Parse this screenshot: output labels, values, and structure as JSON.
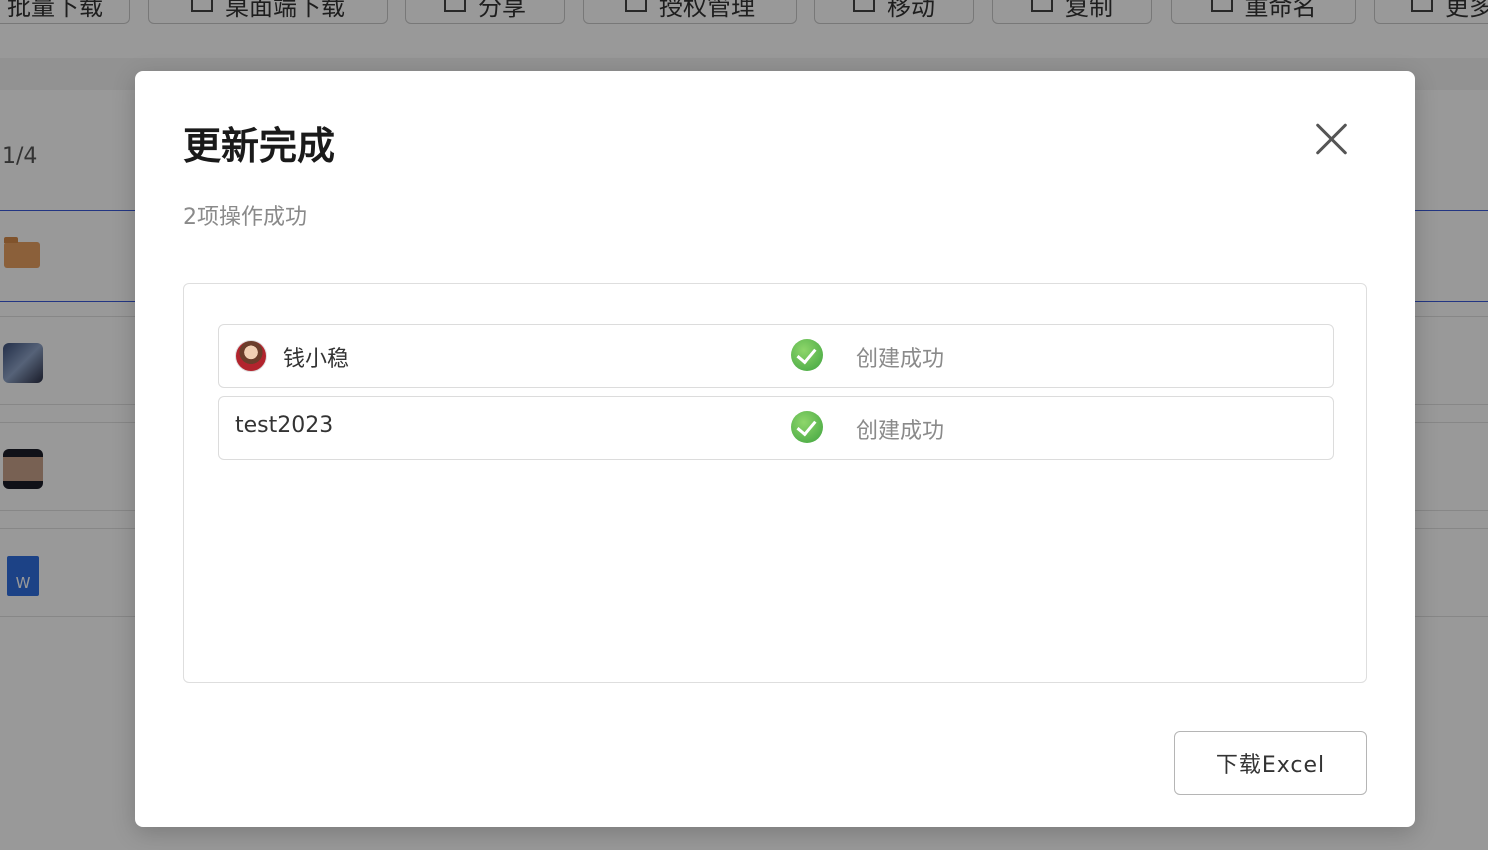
{
  "background": {
    "toolbar_buttons": [
      {
        "label": "批量下载",
        "icon": "download-icon"
      },
      {
        "label": "桌面端下载",
        "icon": "desktop-icon"
      },
      {
        "label": "分享",
        "icon": "share-icon"
      },
      {
        "label": "授权管理",
        "icon": "permission-icon"
      },
      {
        "label": "移动",
        "icon": "move-icon"
      },
      {
        "label": "复制",
        "icon": "copy-icon"
      },
      {
        "label": "重命名",
        "icon": "rename-icon"
      },
      {
        "label": "更多",
        "icon": "more-icon"
      }
    ],
    "counter": "1/4"
  },
  "modal": {
    "title": "更新完成",
    "subtitle": "2项操作成功",
    "close_icon": "close-icon",
    "rows": [
      {
        "name": "钱小稳",
        "has_avatar": true,
        "status": "创建成功",
        "status_icon": "check-circle-icon"
      },
      {
        "name": "test2023",
        "has_avatar": false,
        "status": "创建成功",
        "status_icon": "check-circle-icon"
      }
    ],
    "download_label": "下载Excel"
  },
  "colors": {
    "success": "#4caf50",
    "selection": "#3b5bdb"
  }
}
